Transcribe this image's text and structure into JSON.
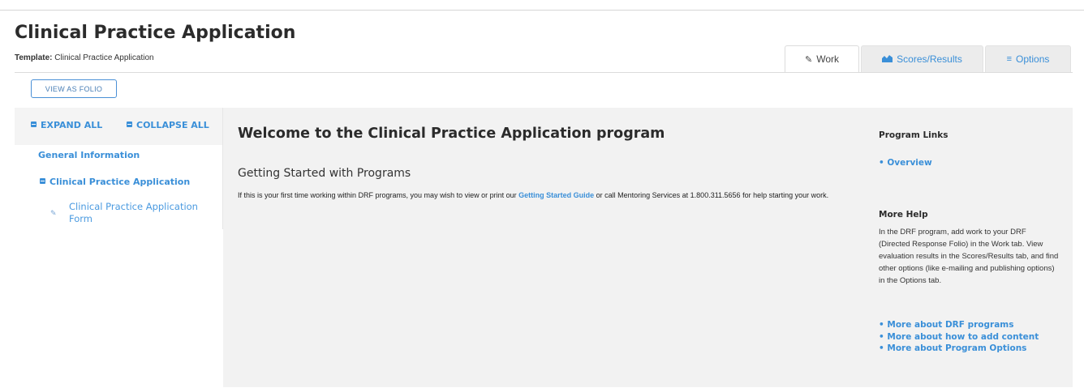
{
  "page": {
    "title": "Clinical Practice Application",
    "template_label": "Template:",
    "template_value": "Clinical Practice Application"
  },
  "tabs": [
    {
      "label": "Work",
      "icon": "edit-icon",
      "active": true
    },
    {
      "label": "Scores/Results",
      "icon": "area-chart-icon",
      "active": false
    },
    {
      "label": "Options",
      "icon": "bars-icon",
      "active": false
    }
  ],
  "toolbar": {
    "view_as_folio": "VIEW AS FOLIO"
  },
  "sidebar": {
    "expand_all": "EXPAND ALL",
    "collapse_all": "COLLAPSE ALL",
    "items": [
      {
        "label": "General Information"
      },
      {
        "label": "Clinical Practice Application"
      },
      {
        "label": "Clinical Practice Application Form"
      }
    ]
  },
  "main": {
    "welcome": "Welcome to the Clinical Practice Application program",
    "getting_started_title": "Getting Started with Programs",
    "para_pre": "If this is your first time working within DRF programs, you may wish to view or print our ",
    "para_link": "Getting Started Guide",
    "para_post": " or call Mentoring Services at 1.800.311.5656 for help starting your work."
  },
  "right": {
    "program_links_title": "Program Links",
    "overview_link": "Overview",
    "more_help_title": "More Help",
    "more_help_text": "In the DRF program, add work to your DRF (Directed Response Folio) in the Work tab. View evaluation results in the Scores/Results tab, and find other options (like e-mailing and publishing options) in the Options tab.",
    "links": [
      "More about DRF programs",
      "More about how to add content",
      "More about Program Options"
    ]
  },
  "colors": {
    "accent": "#3a8fd8",
    "main_bg": "#f2f2f2",
    "tab_inactive_bg": "#ececec"
  }
}
